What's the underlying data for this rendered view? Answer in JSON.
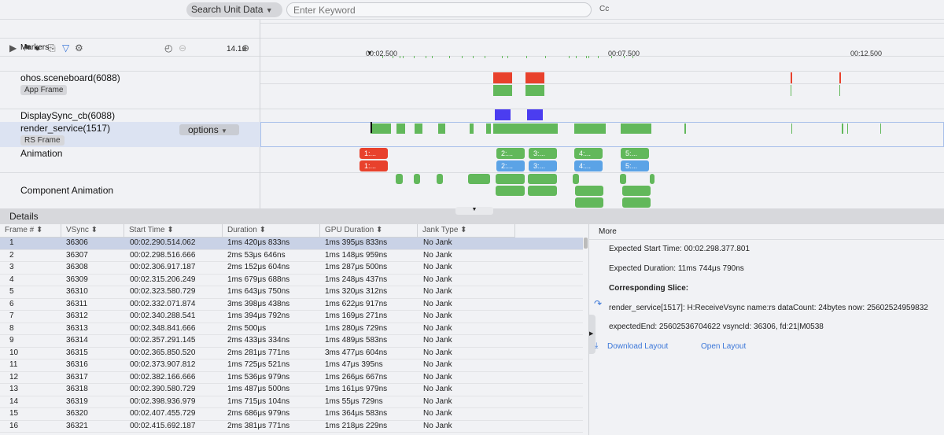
{
  "search": {
    "unit_label": "Search Unit Data",
    "keyword_placeholder": "Enter Keyword",
    "case_label": "Cc"
  },
  "toolbar": {
    "zoom_level": "14.1s"
  },
  "ruler": {
    "ticks": [
      "00:02.500",
      "00:07.500",
      "00:12.500"
    ]
  },
  "tracks": {
    "markers": "Markers",
    "sceneboard": "ohos.sceneboard(6088)",
    "app_frame": "App Frame",
    "displaysync": "DisplaySync_cb(6088)",
    "render_service": "render_service(1517)",
    "rs_frame": "RS Frame",
    "options": "options",
    "animation": "Animation",
    "component_animation": "Component Animation"
  },
  "animation_labels": [
    "1:...",
    "2:...",
    "3:...",
    "4:...",
    "5:..."
  ],
  "colors": {
    "jank": "#e8412c",
    "normal": "#62b85b",
    "vsync": "#4b3df0",
    "anim_blue": "#5ba3e6",
    "selection": "#c9d2e6"
  },
  "details": {
    "title": "Details",
    "columns": [
      "Frame # ⬍",
      "VSync ⬍",
      "Start Time ⬍",
      "Duration ⬍",
      "GPU Duration ⬍",
      "Jank Type ⬍"
    ],
    "rows": [
      [
        "1",
        "36306",
        "00:02.290.514.062",
        "1ms 420μs 833ns",
        "1ms 395μs 833ns",
        "No Jank"
      ],
      [
        "2",
        "36307",
        "00:02.298.516.666",
        "2ms 53μs 646ns",
        "1ms 148μs 959ns",
        "No Jank"
      ],
      [
        "3",
        "36308",
        "00:02.306.917.187",
        "2ms 152μs 604ns",
        "1ms 287μs 500ns",
        "No Jank"
      ],
      [
        "4",
        "36309",
        "00:02.315.206.249",
        "1ms 679μs 688ns",
        "1ms 248μs 437ns",
        "No Jank"
      ],
      [
        "5",
        "36310",
        "00:02.323.580.729",
        "1ms 643μs 750ns",
        "1ms 320μs 312ns",
        "No Jank"
      ],
      [
        "6",
        "36311",
        "00:02.332.071.874",
        "3ms 398μs 438ns",
        "1ms 622μs 917ns",
        "No Jank"
      ],
      [
        "7",
        "36312",
        "00:02.340.288.541",
        "1ms 394μs 792ns",
        "1ms 169μs 271ns",
        "No Jank"
      ],
      [
        "8",
        "36313",
        "00:02.348.841.666",
        "2ms 500μs",
        "1ms 280μs 729ns",
        "No Jank"
      ],
      [
        "9",
        "36314",
        "00:02.357.291.145",
        "2ms 433μs 334ns",
        "1ms 489μs 583ns",
        "No Jank"
      ],
      [
        "10",
        "36315",
        "00:02.365.850.520",
        "2ms 281μs 771ns",
        "3ms 477μs 604ns",
        "No Jank"
      ],
      [
        "11",
        "36316",
        "00:02.373.907.812",
        "1ms 725μs 521ns",
        "1ms 47μs 395ns",
        "No Jank"
      ],
      [
        "12",
        "36317",
        "00:02.382.166.666",
        "1ms 536μs 979ns",
        "1ms 266μs 667ns",
        "No Jank"
      ],
      [
        "13",
        "36318",
        "00:02.390.580.729",
        "1ms 487μs 500ns",
        "1ms 161μs 979ns",
        "No Jank"
      ],
      [
        "14",
        "36319",
        "00:02.398.936.979",
        "1ms 715μs 104ns",
        "1ms 55μs 729ns",
        "No Jank"
      ],
      [
        "15",
        "36320",
        "00:02.407.455.729",
        "2ms 686μs 979ns",
        "1ms 364μs 583ns",
        "No Jank"
      ],
      [
        "16",
        "36321",
        "00:02.415.692.187",
        "2ms 381μs 771ns",
        "1ms 218μs 229ns",
        "No Jank"
      ]
    ]
  },
  "more": {
    "title": "More",
    "expected_start": "Expected Start Time: 00:02.298.377.801",
    "expected_duration": "Expected Duration: 11ms 744μs 790ns",
    "slice_heading": "Corresponding Slice:",
    "slice_line1": "render_service[1517]: H:ReceiveVsync name:rs dataCount: 24bytes now: 25602524959832",
    "slice_line2": "expectedEnd: 25602536704622 vsyncId: 36306, fd:21|M0538",
    "download": "Download Layout",
    "open": "Open Layout"
  }
}
